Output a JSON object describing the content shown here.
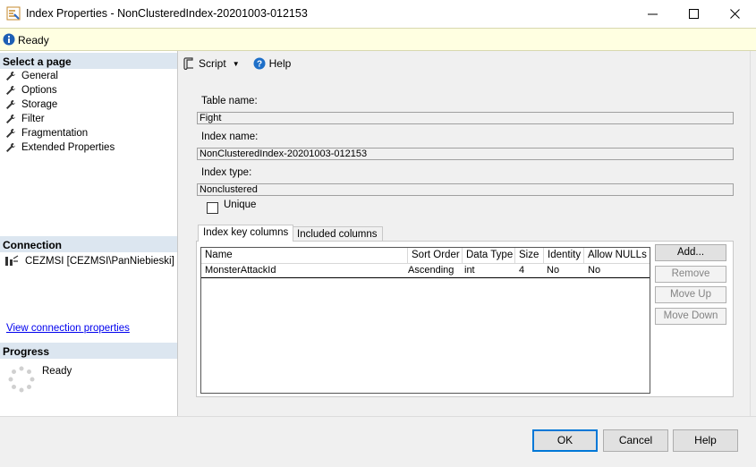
{
  "window": {
    "title": "Index Properties - NonClusteredIndex-20201003-012153",
    "minimize_icon": "minimize-icon",
    "maximize_icon": "maximize-icon",
    "close_icon": "close-icon"
  },
  "status": {
    "text": "Ready",
    "icon": "info-icon"
  },
  "sidebar": {
    "select_page_header": "Select a page",
    "pages": [
      {
        "label": "General",
        "icon": "wrench-icon",
        "selected": true
      },
      {
        "label": "Options",
        "icon": "wrench-icon"
      },
      {
        "label": "Storage",
        "icon": "wrench-icon"
      },
      {
        "label": "Filter",
        "icon": "wrench-icon"
      },
      {
        "label": "Fragmentation",
        "icon": "wrench-icon"
      },
      {
        "label": "Extended Properties",
        "icon": "wrench-icon"
      }
    ],
    "connection_header": "Connection",
    "connection_text": "CEZMSI [CEZMSI\\PanNiebieski]",
    "connection_link": "View connection properties",
    "progress_header": "Progress",
    "progress_text": "Ready"
  },
  "toolbar": {
    "script_label": "Script",
    "help_label": "Help"
  },
  "form": {
    "table_name_label": "Table name:",
    "table_name_value": "Fight",
    "index_name_label": "Index name:",
    "index_name_value": "NonClusteredIndex-20201003-012153",
    "index_type_label": "Index type:",
    "index_type_value": "Nonclustered",
    "unique_label": "Unique",
    "unique_checked": false
  },
  "tabs": [
    {
      "label": "Index key columns",
      "active": true
    },
    {
      "label": "Included columns",
      "active": false
    }
  ],
  "grid": {
    "columns": [
      "Name",
      "Sort Order",
      "Data Type",
      "Size",
      "Identity",
      "Allow NULLs"
    ],
    "rows": [
      [
        "MonsterAttackId",
        "Ascending",
        "int",
        "4",
        "No",
        "No"
      ]
    ]
  },
  "side_buttons": {
    "add": "Add...",
    "remove": "Remove",
    "move_up": "Move Up",
    "move_down": "Move Down"
  },
  "dialog_buttons": {
    "ok": "OK",
    "cancel": "Cancel",
    "help": "Help"
  },
  "colors": {
    "accent": "#0078d7",
    "status_bg": "#ffffe1",
    "section_header_bg": "#dce6f0",
    "link": "#0000ee"
  }
}
